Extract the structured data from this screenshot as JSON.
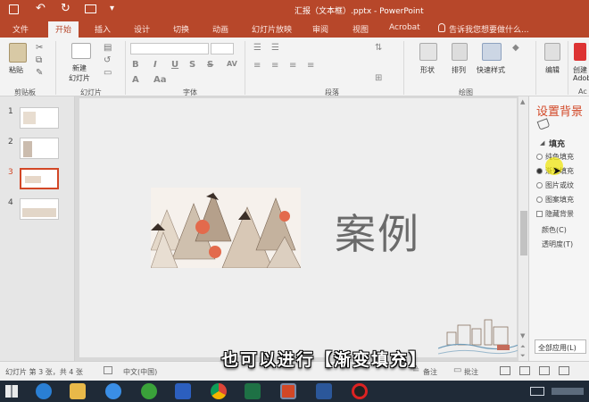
{
  "window": {
    "title": "汇报（文本框）.pptx - PowerPoint",
    "accent": "#b7472a"
  },
  "tabs": [
    {
      "label": "文件"
    },
    {
      "label": "开始"
    },
    {
      "label": "插入"
    },
    {
      "label": "设计"
    },
    {
      "label": "切换"
    },
    {
      "label": "动画"
    },
    {
      "label": "幻灯片放映"
    },
    {
      "label": "审阅"
    },
    {
      "label": "视图"
    },
    {
      "label": "Acrobat"
    }
  ],
  "tellme": "告诉我您想要做什么...",
  "ribbon": {
    "paste": "粘贴",
    "new_slide_1": "新建",
    "new_slide_2": "幻灯片",
    "shapes": "形状",
    "arrange": "排列",
    "quick_styles": "快速样式",
    "edit": "编辑",
    "create_1": "创建",
    "create_2": "Adob",
    "groups": {
      "clipboard": "剪贴板",
      "slides": "幻灯片",
      "font": "字体",
      "paragraph": "段落",
      "drawing": "绘图",
      "adobe": "Ac"
    }
  },
  "slides": [
    {
      "num": "1"
    },
    {
      "num": "2"
    },
    {
      "num": "3"
    },
    {
      "num": "4"
    }
  ],
  "slide": {
    "text": "案例"
  },
  "format_pane": {
    "title": "设置背景",
    "section": "填充",
    "options": [
      "纯色填充",
      "渐变填充",
      "图片或纹",
      "图案填充"
    ],
    "hide_bg": "隐藏背景",
    "color": "颜色(C)",
    "transparency": "透明度(T)",
    "apply_all": "全部应用(L)"
  },
  "status": {
    "slide_info": "幻灯片 第 3 张，共 4 张",
    "language": "中文(中国)",
    "notes": "备注",
    "comments": "批注"
  },
  "caption": "也可以进行【渐变填充】"
}
